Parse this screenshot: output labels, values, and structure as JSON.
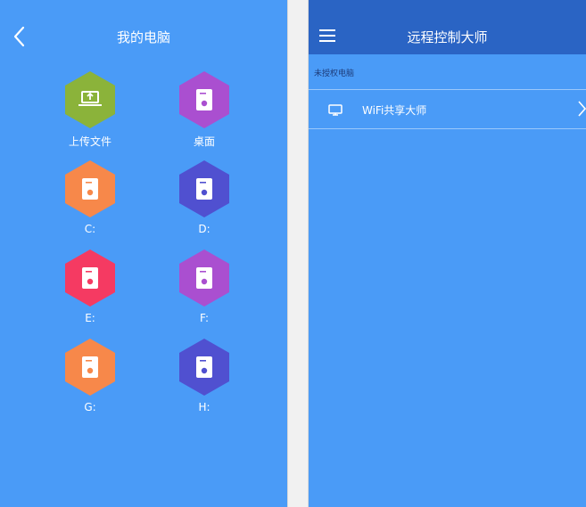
{
  "colors": {
    "background": "#4a9bf7",
    "header_dark": "#2a64c4",
    "green": "#8bb33a",
    "purple": "#aa4fd0",
    "orange": "#f7884a",
    "indigo": "#5050d0",
    "red": "#f53a62"
  },
  "left_screen": {
    "header": {
      "back_icon": "chevron-left-icon",
      "title": "我的电脑"
    },
    "tiles": [
      {
        "label": "上传文件",
        "icon": "upload-laptop-icon",
        "color": "#8bb33a"
      },
      {
        "label": "桌面",
        "icon": "hard-drive-icon",
        "color": "#aa4fd0"
      },
      {
        "label": "C:",
        "icon": "hard-drive-icon",
        "color": "#f7884a"
      },
      {
        "label": "D:",
        "icon": "hard-drive-icon",
        "color": "#5050d0"
      },
      {
        "label": "E:",
        "icon": "hard-drive-icon",
        "color": "#f53a62"
      },
      {
        "label": "F:",
        "icon": "hard-drive-icon",
        "color": "#aa4fd0"
      },
      {
        "label": "G:",
        "icon": "hard-drive-icon",
        "color": "#f7884a"
      },
      {
        "label": "H:",
        "icon": "hard-drive-icon",
        "color": "#5050d0"
      }
    ]
  },
  "right_screen": {
    "header": {
      "menu_icon": "hamburger-menu-icon",
      "title": "远程控制大师"
    },
    "section_label": "未授权电脑",
    "items": [
      {
        "label": "WiFi共享大师",
        "icon": "monitor-icon",
        "chevron": "chevron-right-icon"
      }
    ]
  }
}
